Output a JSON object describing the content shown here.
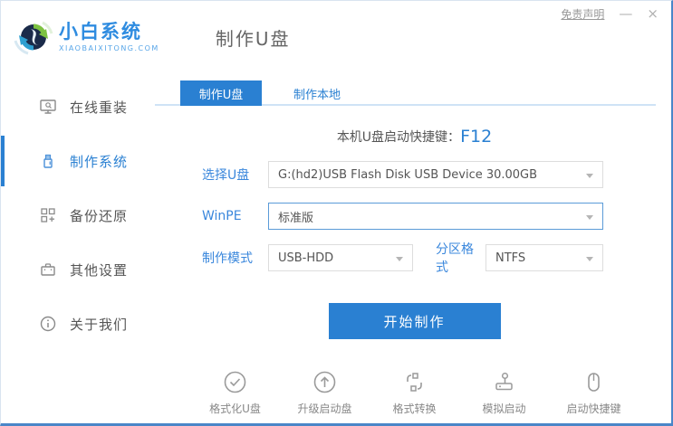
{
  "window": {
    "disclaimer": "免责声明",
    "minimize": "—",
    "close": "×"
  },
  "header": {
    "brand_name": "小白系统",
    "brand_domain": "XIAOBAIXITONG.COM",
    "page_title": "制作U盘"
  },
  "sidebar": {
    "items": [
      {
        "label": "在线重装",
        "icon": "monitor-reinstall-icon",
        "active": false
      },
      {
        "label": "制作系统",
        "icon": "usb-drive-icon",
        "active": true
      },
      {
        "label": "备份还原",
        "icon": "backup-restore-icon",
        "active": false
      },
      {
        "label": "其他设置",
        "icon": "settings-case-icon",
        "active": false
      },
      {
        "label": "关于我们",
        "icon": "info-icon",
        "active": false
      }
    ]
  },
  "tabs": [
    {
      "label": "制作U盘",
      "active": true
    },
    {
      "label": "制作本地",
      "active": false
    }
  ],
  "main": {
    "hotkey_label": "本机U盘启动快捷键：",
    "hotkey_value": "F12",
    "fields": {
      "usb_label": "选择U盘",
      "usb_value": "G:(hd2)USB Flash Disk USB Device 30.00GB",
      "winpe_label": "WinPE",
      "winpe_value": "标准版",
      "mode_label": "制作模式",
      "mode_value": "USB-HDD",
      "partition_label": "分区格式",
      "partition_value": "NTFS"
    },
    "start_button": "开始制作"
  },
  "footer_tools": [
    {
      "label": "格式化U盘",
      "icon": "check-circle-icon"
    },
    {
      "label": "升级启动盘",
      "icon": "upload-circle-icon"
    },
    {
      "label": "格式转换",
      "icon": "convert-icon"
    },
    {
      "label": "模拟启动",
      "icon": "joystick-icon"
    },
    {
      "label": "启动快捷键",
      "icon": "mouse-icon"
    }
  ],
  "colors": {
    "primary_blue": "#2a80d2",
    "label_blue": "#3a87dc",
    "tab_underline": "#cfe3f6",
    "text_gray": "#555555",
    "icon_gray": "#999999",
    "logo_green": "#7dc242",
    "logo_blue": "#2e9fd0"
  }
}
